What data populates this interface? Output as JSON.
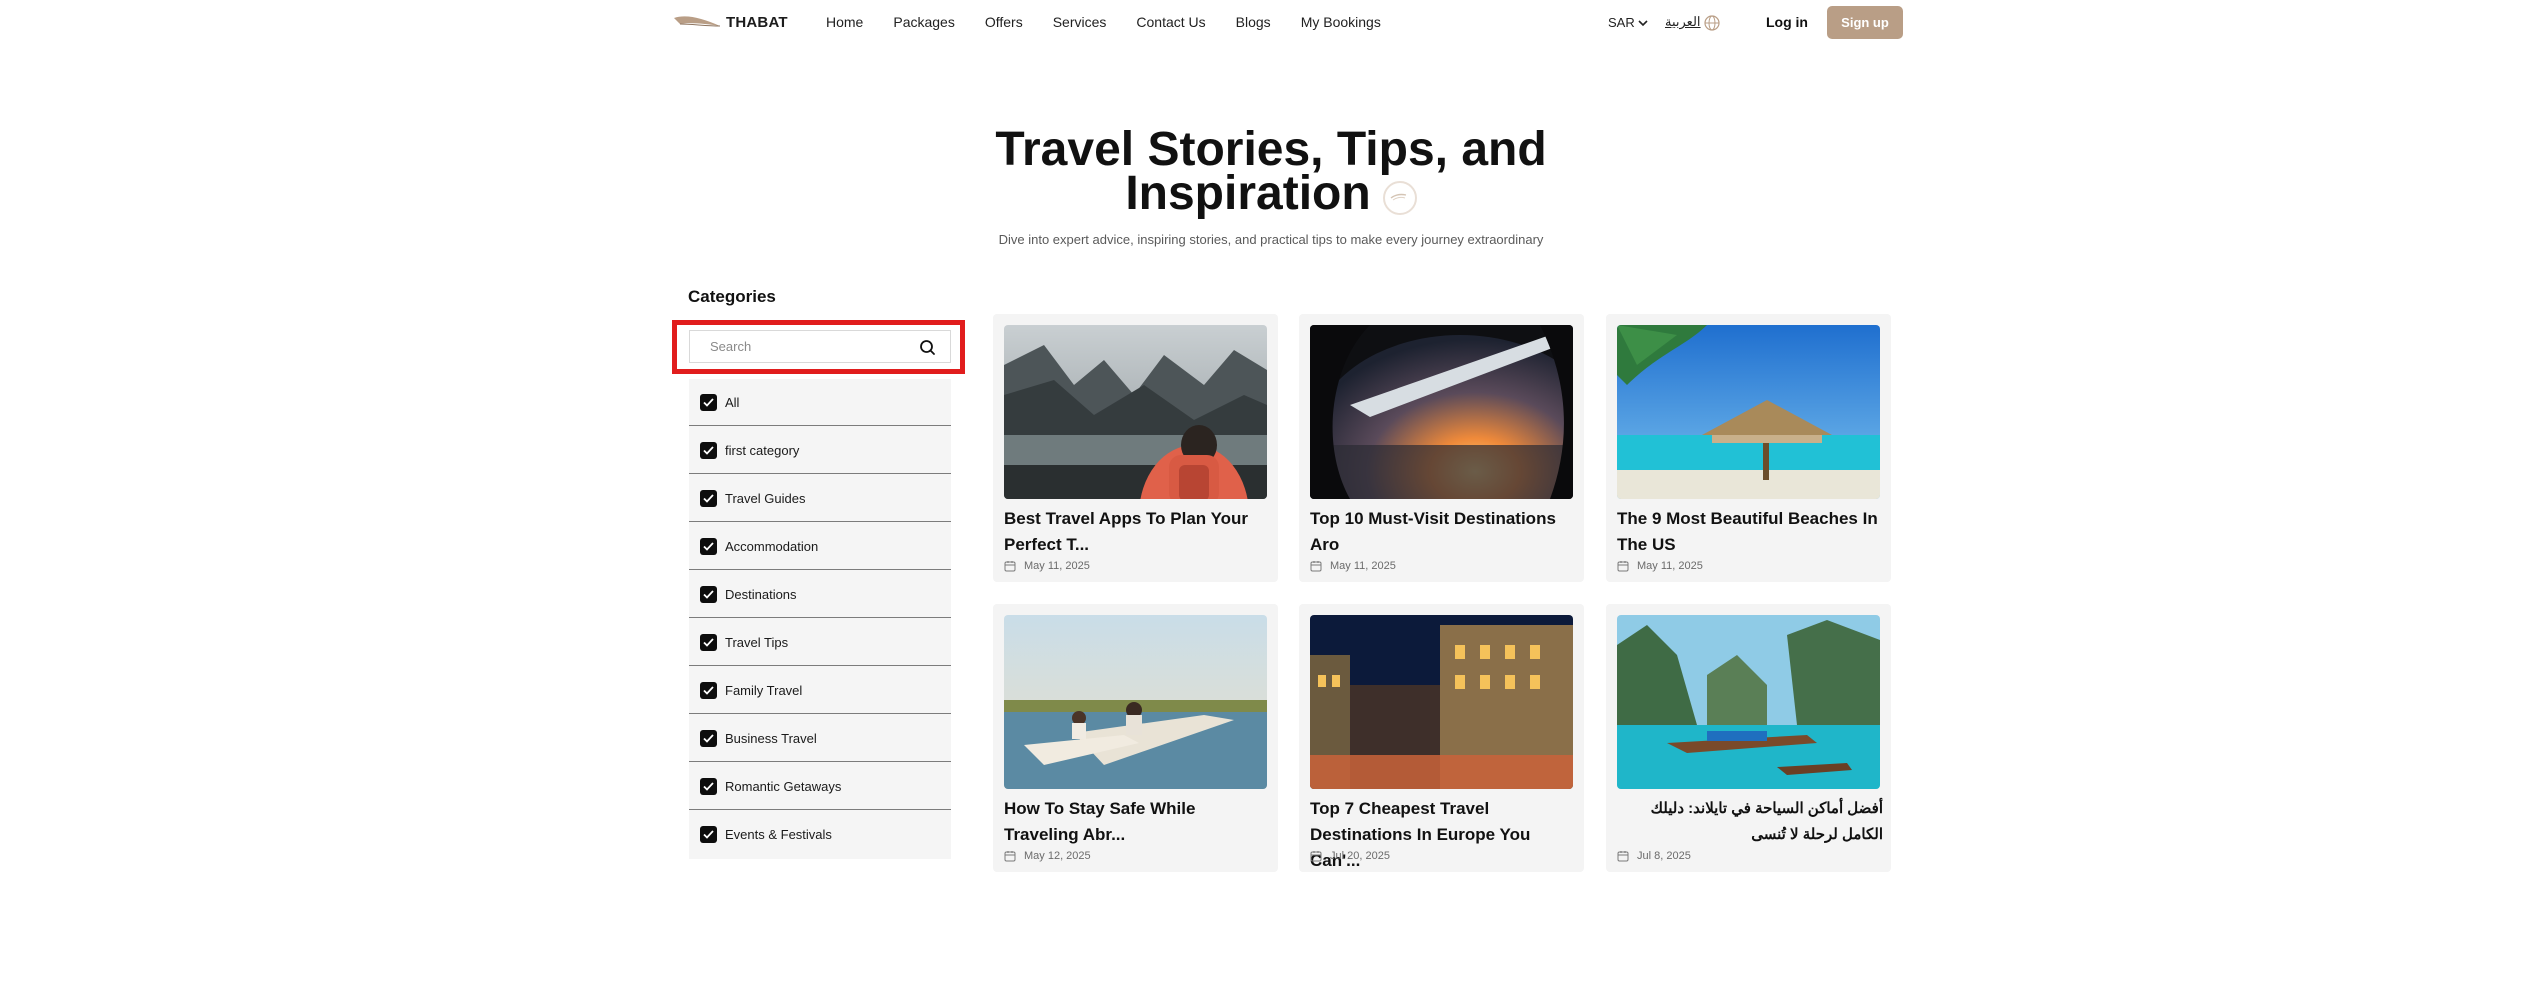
{
  "nav": {
    "logo_text": "THABAT",
    "links": [
      "Home",
      "Packages",
      "Offers",
      "Services",
      "Contact Us",
      "Blogs",
      "My Bookings"
    ],
    "currency": "SAR",
    "language": "العربية",
    "login": "Log in",
    "signup": "Sign up",
    "signup_color": "#b99e86"
  },
  "hero": {
    "title_line1": "Travel Stories, Tips, and",
    "title_line2": "Inspiration",
    "subtitle": "Dive into expert advice, inspiring stories, and practical tips to make every journey extraordinary"
  },
  "categories": {
    "title": "Categories",
    "search_placeholder": "Search",
    "items": [
      {
        "label": "All",
        "checked": true
      },
      {
        "label": "first category",
        "checked": true
      },
      {
        "label": "Travel Guides",
        "checked": true
      },
      {
        "label": "Accommodation",
        "checked": true
      },
      {
        "label": "Destinations",
        "checked": true
      },
      {
        "label": "Travel Tips",
        "checked": true
      },
      {
        "label": "Family Travel",
        "checked": true
      },
      {
        "label": "Business Travel",
        "checked": true
      },
      {
        "label": "Romantic Getaways",
        "checked": true
      },
      {
        "label": "Events & Festivals",
        "checked": true
      }
    ]
  },
  "posts": [
    {
      "title": "Best Travel Apps To Plan Your Perfect T...",
      "date": "May 11, 2025",
      "image": "hiker-mountain-lake"
    },
    {
      "title": "Top 10 Must-Visit Destinations Aro",
      "date": "May 11, 2025",
      "image": "airplane-window-sunset"
    },
    {
      "title": "The 9 Most Beautiful Beaches In The US",
      "date": "May 11, 2025",
      "image": "tropical-beach-hut"
    },
    {
      "title": "How To Stay Safe While Traveling Abr...",
      "date": "May 12, 2025",
      "image": "canoe-lake"
    },
    {
      "title": "Top 7 Cheapest Travel Destinations In Europe You Can'...",
      "date": "Jul 20, 2025",
      "image": "european-street-night"
    },
    {
      "title": "أفضل أماكن السياحة في تايلاند: دليلك الكامل لرحلة لا تُنسى",
      "date": "Jul 8, 2025",
      "image": "thailand-longboat"
    }
  ],
  "highlight_color": "#e11d1d"
}
